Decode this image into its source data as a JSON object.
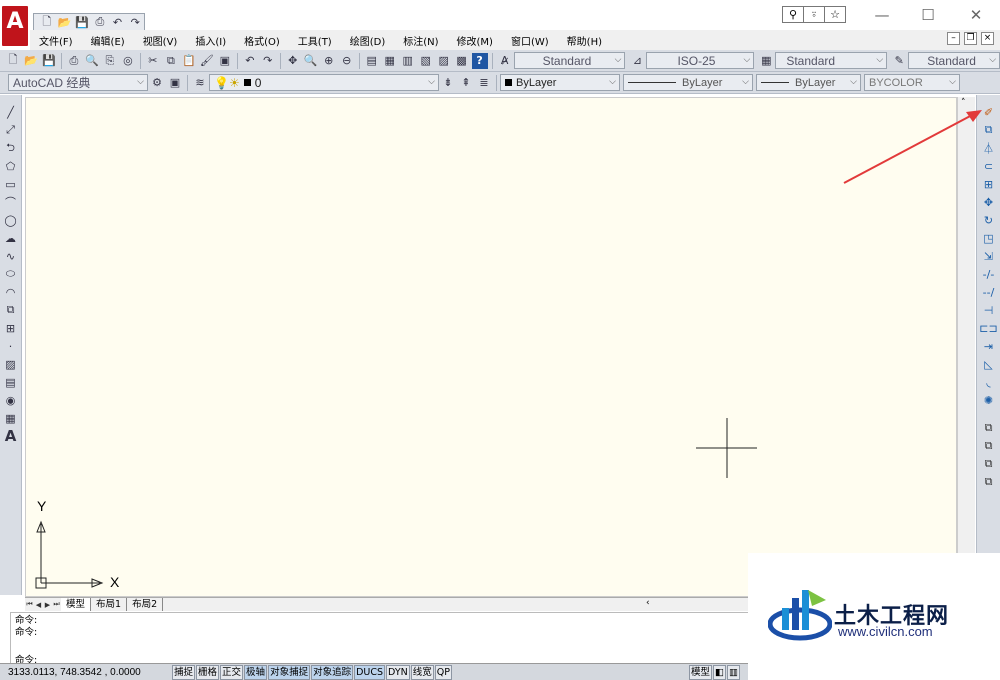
{
  "title_bar": {
    "logo_letter": "A",
    "qat_icons": [
      "new-icon",
      "open-icon",
      "save-icon",
      "print-icon",
      "undo-icon",
      "redo-icon"
    ],
    "search_icons": [
      "search-icon",
      "user-icon",
      "star-icon"
    ],
    "window_controls": [
      "—",
      "☐",
      "✕"
    ]
  },
  "menu": {
    "items": [
      "文件(F)",
      "编辑(E)",
      "视图(V)",
      "插入(I)",
      "格式(O)",
      "工具(T)",
      "绘图(D)",
      "标注(N)",
      "修改(M)",
      "窗口(W)",
      "帮助(H)"
    ]
  },
  "styles_toolbar": {
    "text_style": "Standard",
    "dim_style": "ISO-25",
    "table_style": "Standard",
    "multileader_style": "Standard"
  },
  "layers_toolbar": {
    "workspace": "AutoCAD 经典",
    "layer": "0",
    "color": "ByLayer",
    "linetype": "ByLayer",
    "lineweight": "ByLayer",
    "plotstyle": "BYCOLOR"
  },
  "ucs": {
    "x_label": "X",
    "y_label": "Y"
  },
  "layout_tabs": [
    "模型",
    "布局1",
    "布局2"
  ],
  "command_line": {
    "history": [
      "命令:",
      "命令:"
    ],
    "prompt": "命令:"
  },
  "status_bar": {
    "coordinates": "3133.0113, 748.3542 , 0.0000",
    "toggles": [
      "捕捉",
      "栅格",
      "正交",
      "极轴",
      "对象捕捉",
      "对象追踪",
      "DUCS",
      "DYN",
      "线宽",
      "QP"
    ],
    "model_label": "模型"
  },
  "watermark": {
    "name": "土木工程网",
    "url": "www.civilcn.com"
  },
  "colors": {
    "canvas_bg": "#fffdf0",
    "logo_red": "#c0141b",
    "annotation_arrow": "#e23a3a"
  }
}
